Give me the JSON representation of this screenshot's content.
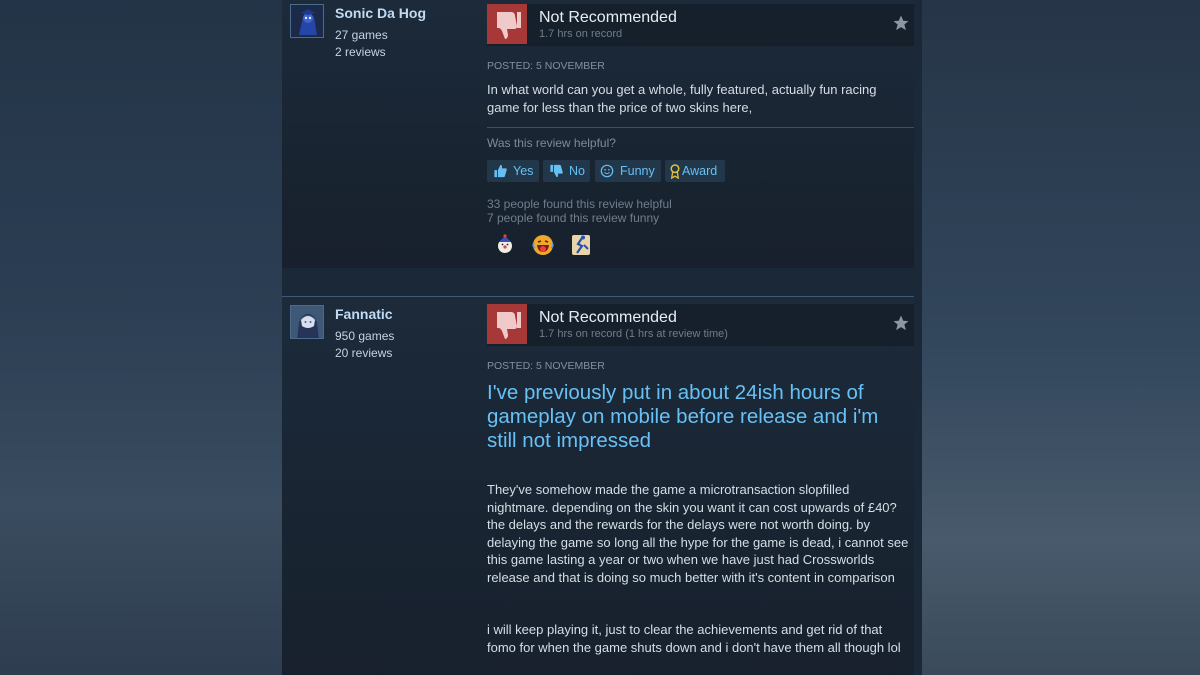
{
  "reviews": [
    {
      "author": {
        "name": "Sonic Da Hog",
        "games": "27 games",
        "reviews": "2 reviews"
      },
      "verdict": "Not Recommended",
      "hours": "1.7 hrs on record",
      "posted": "POSTED: 5 NOVEMBER",
      "text": "In what world can you get a whole, fully featured, actually fun racing game for less than the price of two skins here,",
      "helpful_question": "Was this review helpful?",
      "buttons": {
        "yes": "Yes",
        "no": "No",
        "funny": "Funny",
        "award": "Award"
      },
      "helpful_count": "33 people found this review helpful",
      "funny_count": "7 people found this review funny",
      "awards": [
        "clown-award-icon",
        "laughing-award-icon",
        "runner-award-icon"
      ]
    },
    {
      "author": {
        "name": "Fannatic",
        "games": "950 games",
        "reviews": "20 reviews"
      },
      "verdict": "Not Recommended",
      "hours": "1.7 hrs on record (1 hrs at review time)",
      "posted": "POSTED: 5 NOVEMBER",
      "title": "I've previously put in about 24ish hours of gameplay on mobile before release and i'm still not impressed",
      "paragraph1": "They've somehow made the game a microtransaction slopfilled nightmare. depending on the skin you want it can cost upwards of £40? the delays and the rewards for the delays were not worth doing. by delaying the game so long all the hype for the game is dead, i cannot see this game lasting a year or two when we have just had Crossworlds release and that is doing so much better with it's content in comparison",
      "paragraph2": "i will keep playing it, just to clear the achievements and get rid of that fomo for when the game shuts down and i don't have them all though lol"
    }
  ],
  "colors": {
    "thumb_down": "#a73838",
    "link": "#66c0f4",
    "title": "#67c1f5"
  }
}
